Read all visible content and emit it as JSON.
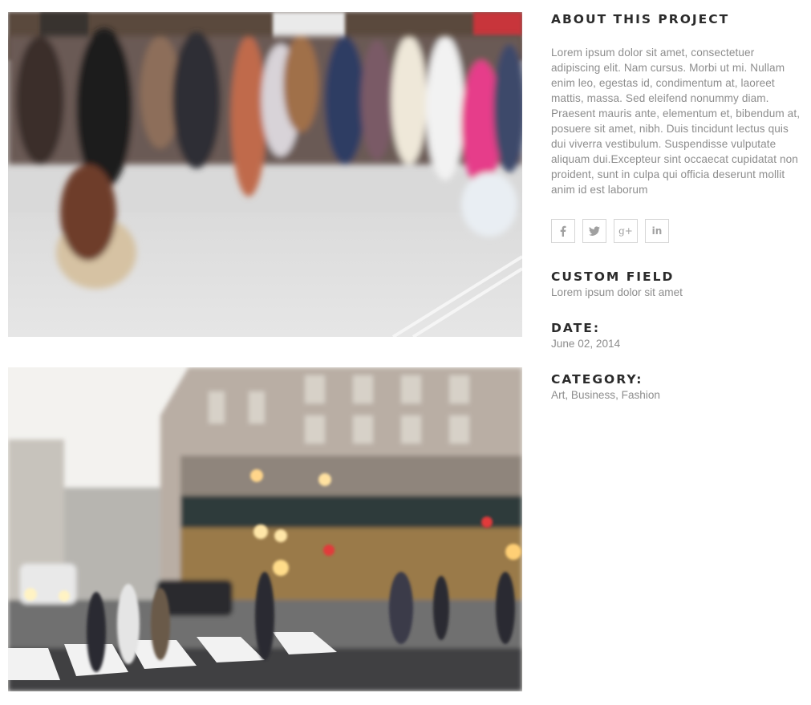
{
  "project": {
    "about_heading": "ABOUT THIS PROJECT",
    "about_text": "Lorem ipsum dolor sit amet, consectetuer adipiscing elit. Nam cursus. Morbi ut mi. Nullam enim leo, egestas id, condimentum at, laoreet mattis, massa. Sed eleifend nonummy diam. Praesent mauris ante, elementum et, bibendum at, posuere sit amet, nibh. Duis tincidunt lectus quis dui viverra vestibulum. Suspendisse vulputate aliquam dui.Excepteur sint occaecat cupidatat non proident, sunt in culpa qui officia deserunt mollit anim id est laborum"
  },
  "social": [
    {
      "icon": "facebook-icon",
      "glyph": "f"
    },
    {
      "icon": "twitter-icon",
      "glyph": ""
    },
    {
      "icon": "google-plus-icon",
      "glyph": "g+"
    },
    {
      "icon": "linkedin-icon",
      "glyph": "in"
    }
  ],
  "custom_field": {
    "label": "CUSTOM FIELD",
    "value": "Lorem ipsum dolor sit amet"
  },
  "date": {
    "label": "DATE:",
    "value": "June 02, 2014"
  },
  "category": {
    "label": "CATEGORY:",
    "value": "Art, Business, Fashion"
  },
  "images": [
    {
      "subject": "crowd crossing street (motion blur)"
    },
    {
      "subject": "pedestrians crossing in front of city building (blurred)"
    }
  ]
}
